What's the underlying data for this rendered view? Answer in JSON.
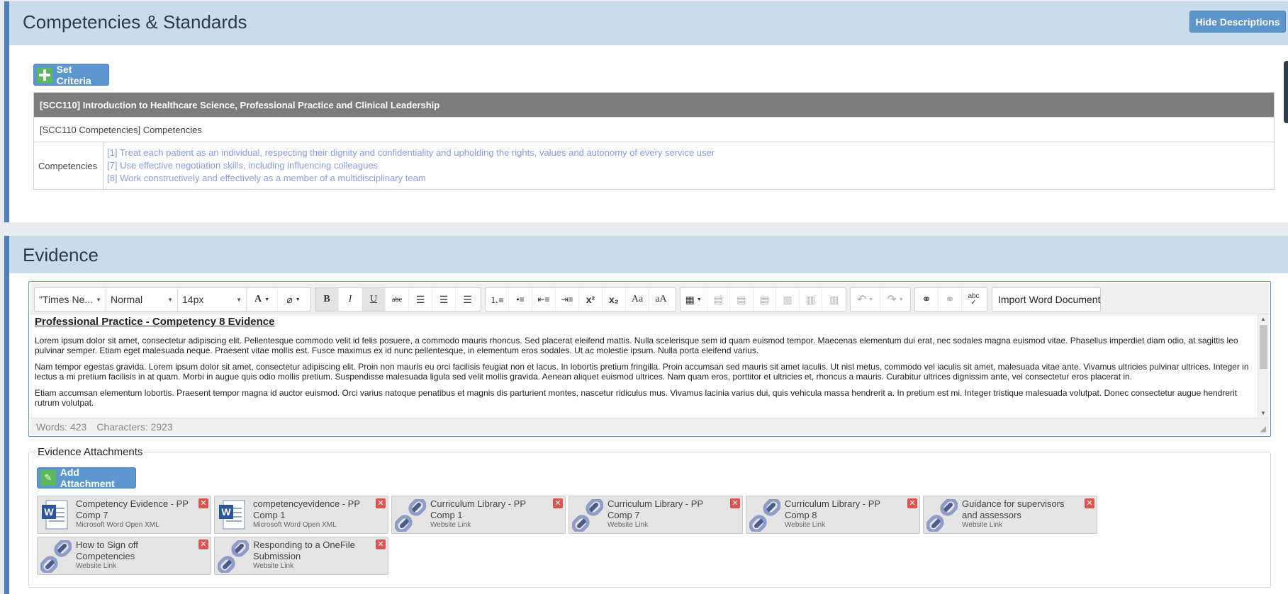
{
  "competencies_panel": {
    "title": "Competencies & Standards",
    "hide_descriptions_label": "Hide Descriptions",
    "set_criteria_label": "Set Criteria",
    "unit_header": "[SCC110] Introduction to Healthcare Science, Professional Practice and Clinical Leadership",
    "group_header": "[SCC110 Competencies] Competencies",
    "row_label": "Competencies",
    "items": [
      "[1] Treat each patient as an individual, respecting their dignity and confidentiality and upholding the rights, values and autonomy of every service user",
      "[7] Use effective negotiation skills, including influencing colleagues",
      "[8] Work constructively and effectively as a member of a multidisciplinary team"
    ]
  },
  "evidence_panel": {
    "title": "Evidence",
    "toolbar": {
      "font_family": "\"Times Ne...",
      "format": "Normal",
      "font_size": "14px",
      "import_label": "Import Word Document",
      "icons": [
        "font-color-icon",
        "highlight-icon",
        "bold-icon",
        "italic-icon",
        "underline-icon",
        "strikethrough-icon",
        "align-left-icon",
        "align-center-icon",
        "align-right-icon",
        "ordered-list-icon",
        "bullet-list-icon",
        "outdent-icon",
        "indent-icon",
        "superscript-icon",
        "subscript-icon",
        "capitalize-icon",
        "lowercase-icon",
        "table-icon",
        "undo-icon",
        "redo-icon",
        "link-icon",
        "unlink-icon",
        "spellcheck-icon"
      ]
    },
    "content": {
      "heading": "Professional Practice - Competency 8 Evidence",
      "paragraphs": [
        "Lorem ipsum dolor sit amet, consectetur adipiscing elit. Pellentesque commodo velit id felis posuere, a commodo mauris rhoncus. Sed placerat eleifend mattis. Nulla scelerisque sem id quam euismod tempor. Maecenas elementum dui erat, nec sodales magna euismod vitae. Phasellus imperdiet diam odio, at sagittis leo pulvinar semper. Etiam eget malesuada neque. Praesent vitae mollis est. Fusce maximus ex id nunc pellentesque, in elementum eros sodales. Ut ac molestie ipsum. Nulla porta eleifend varius.",
        "Nam tempor egestas gravida. Lorem ipsum dolor sit amet, consectetur adipiscing elit. Proin non mauris eu orci facilisis feugiat non et lacus. In lobortis pretium fringilla. Proin accumsan sed mauris sit amet iaculis. Ut nisl metus, commodo vel iaculis sit amet, malesuada vitae ante. Vivamus ultricies pulvinar ultrices. Integer in lectus a mi pretium facilisis in at quam. Morbi in augue quis odio mollis pretium. Suspendisse malesuada ligula sed velit mollis gravida. Aenean aliquet euismod ultrices. Nam quam eros, porttitor et ultricies et, rhoncus a mauris. Curabitur ultrices dignissim ante, vel consectetur eros placerat in.",
        "Etiam accumsan elementum lobortis. Praesent tempor magna id auctor euismod. Orci varius natoque penatibus et magnis dis parturient montes, nascetur ridiculus mus. Vivamus lacinia varius dui, quis vehicula massa hendrerit a. In pretium est mi. Integer tristique malesuada volutpat. Donec consectetur augue hendrerit rutrum volutpat."
      ]
    },
    "status": {
      "words": "Words: 423",
      "characters": "Characters: 2923"
    }
  },
  "attachments": {
    "legend": "Evidence Attachments",
    "add_label": "Add Attachment",
    "items": [
      {
        "name": "Competency Evidence - PP Comp 7",
        "type": "Microsoft Word Open XML",
        "icon": "word-document-icon"
      },
      {
        "name": "competencyevidence - PP Comp 1",
        "type": "Microsoft Word Open XML",
        "icon": "word-document-icon"
      },
      {
        "name": "Curriculum Library - PP Comp 1",
        "type": "Website Link",
        "icon": "link-chain-icon"
      },
      {
        "name": "Curriculum Library - PP Comp 7",
        "type": "Website Link",
        "icon": "link-chain-icon"
      },
      {
        "name": "Curriculum Library - PP Comp 8",
        "type": "Website Link",
        "icon": "link-chain-icon"
      },
      {
        "name": "Guidance for supervisors and assessors",
        "type": "Website Link",
        "icon": "link-chain-icon"
      },
      {
        "name": "How to Sign off Competencies",
        "type": "Website Link",
        "icon": "link-chain-icon"
      },
      {
        "name": "Responding to a OneFile Submission",
        "type": "Website Link",
        "icon": "link-chain-icon"
      }
    ]
  },
  "colors": {
    "panel_header": "#c9dcec",
    "accent": "#4f7fb8",
    "button": "#5c94cc",
    "table_header": "#7c7c7c",
    "link": "#8a99ec",
    "delete": "#d9534f"
  }
}
